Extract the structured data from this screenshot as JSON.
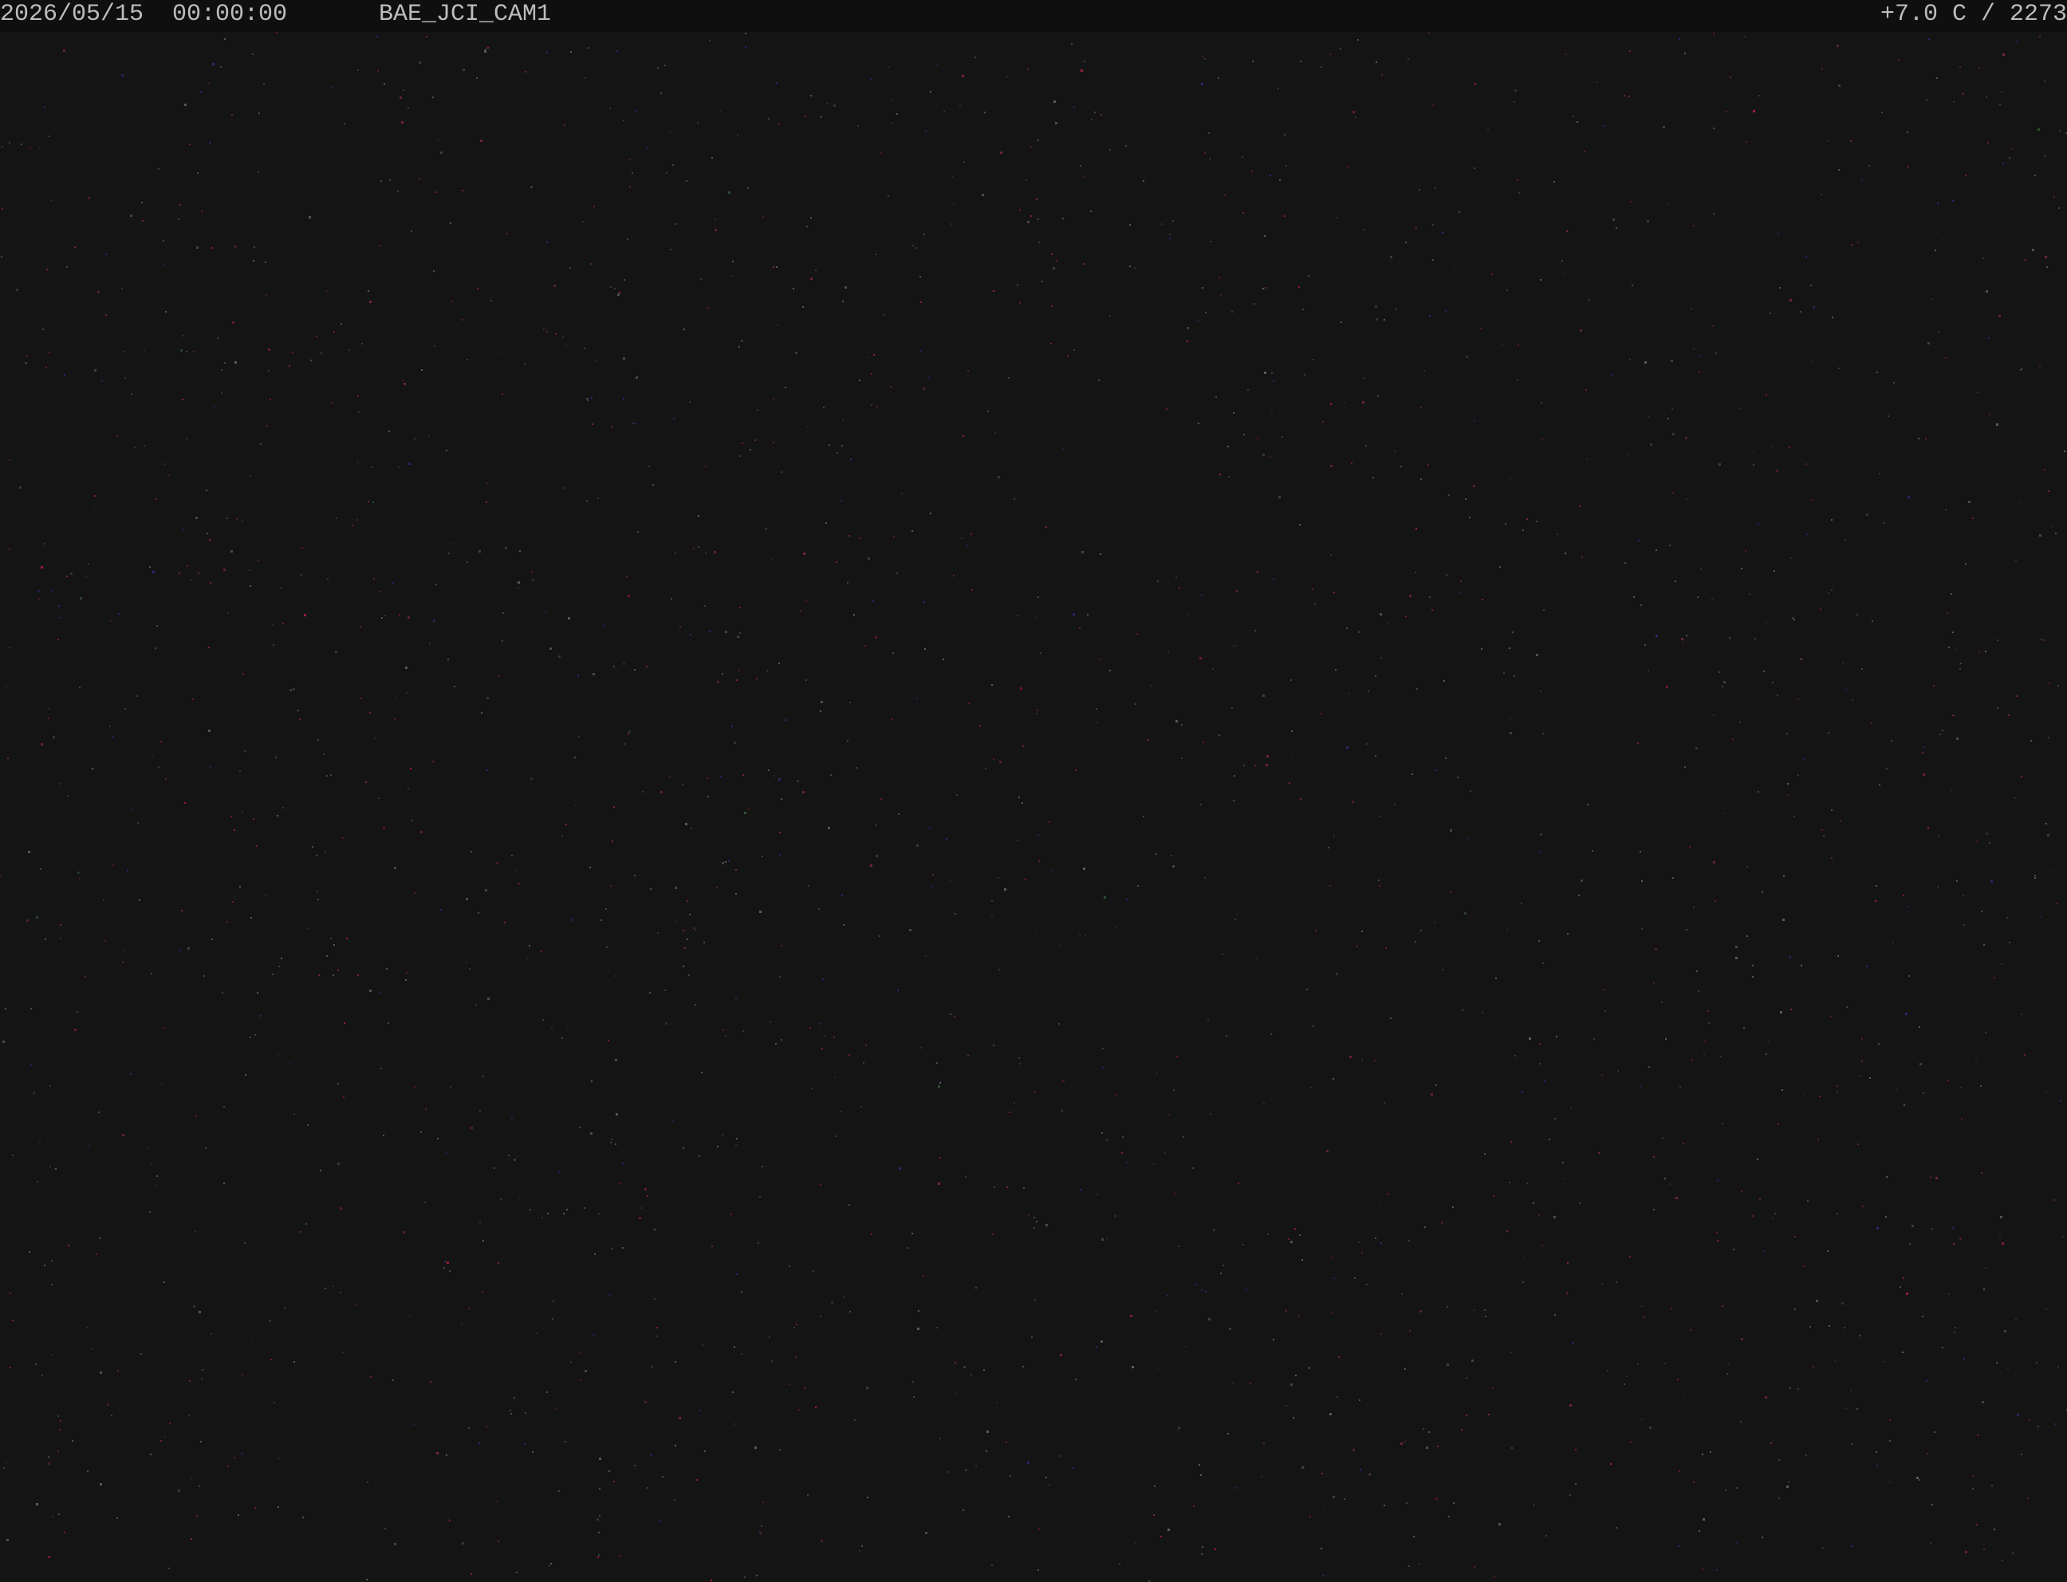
{
  "overlay": {
    "timestamp": "2026/05/15  00:00:00",
    "camera_id": "BAE_JCI_CAM1",
    "status": "+7.0 C / 2273"
  },
  "image": {
    "background_color": "#141414",
    "noise_colors": [
      "#8a2a3a",
      "#3a2a8a",
      "#3a5a3a",
      "#6a6a6a",
      "#c02040"
    ]
  }
}
